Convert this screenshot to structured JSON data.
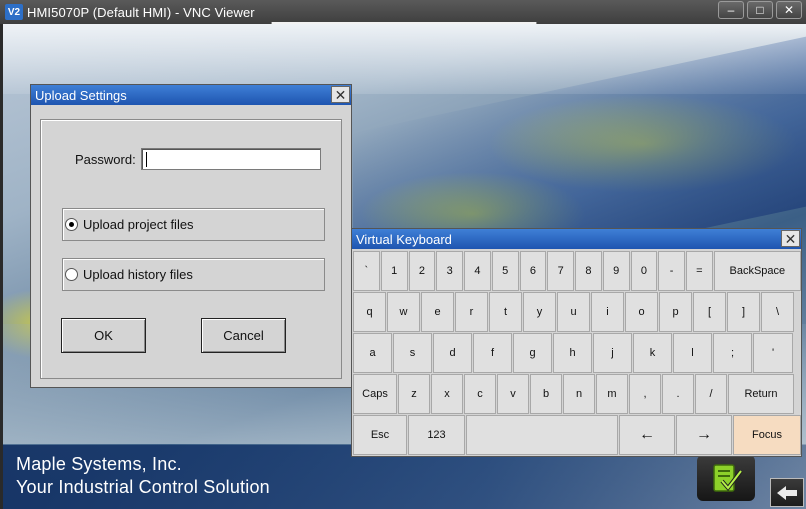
{
  "window": {
    "title": "HMI5070P (Default HMI) - VNC Viewer",
    "logo": "V2",
    "controls": [
      "–",
      "□",
      "✕"
    ]
  },
  "upload_settings": {
    "title": "Upload Settings",
    "password_label": "Password:",
    "password_value": "",
    "options": [
      {
        "label": "Upload project files",
        "selected": true
      },
      {
        "label": "Upload history files",
        "selected": false
      }
    ],
    "ok_label": "OK",
    "cancel_label": "Cancel"
  },
  "keyboard": {
    "title": "Virtual Keyboard",
    "rows": [
      [
        "`",
        "1",
        "2",
        "3",
        "4",
        "5",
        "6",
        "7",
        "8",
        "9",
        "0",
        "-",
        "=",
        "BackSpace"
      ],
      [
        "q",
        "w",
        "e",
        "r",
        "t",
        "y",
        "u",
        "i",
        "o",
        "p",
        "[",
        "]",
        "\\"
      ],
      [
        "a",
        "s",
        "d",
        "f",
        "g",
        "h",
        "j",
        "k",
        "l",
        ";",
        "'"
      ],
      [
        "Caps",
        "z",
        "x",
        "c",
        "v",
        "b",
        "n",
        "m",
        ",",
        ".",
        "/",
        "Return"
      ],
      [
        "Esc",
        "123",
        "",
        "←",
        "→",
        "Focus"
      ]
    ]
  },
  "banner": {
    "line1": "Maple Systems, Inc.",
    "line2": "Your Industrial Control Solution"
  },
  "icons": {
    "confirm": "checkmark-document-icon",
    "back": "back-arrow-icon"
  },
  "colors": {
    "title_blue": "#1e55b0",
    "focus_key": "#f6dcc1",
    "confirm_green": "#8dd12a"
  }
}
